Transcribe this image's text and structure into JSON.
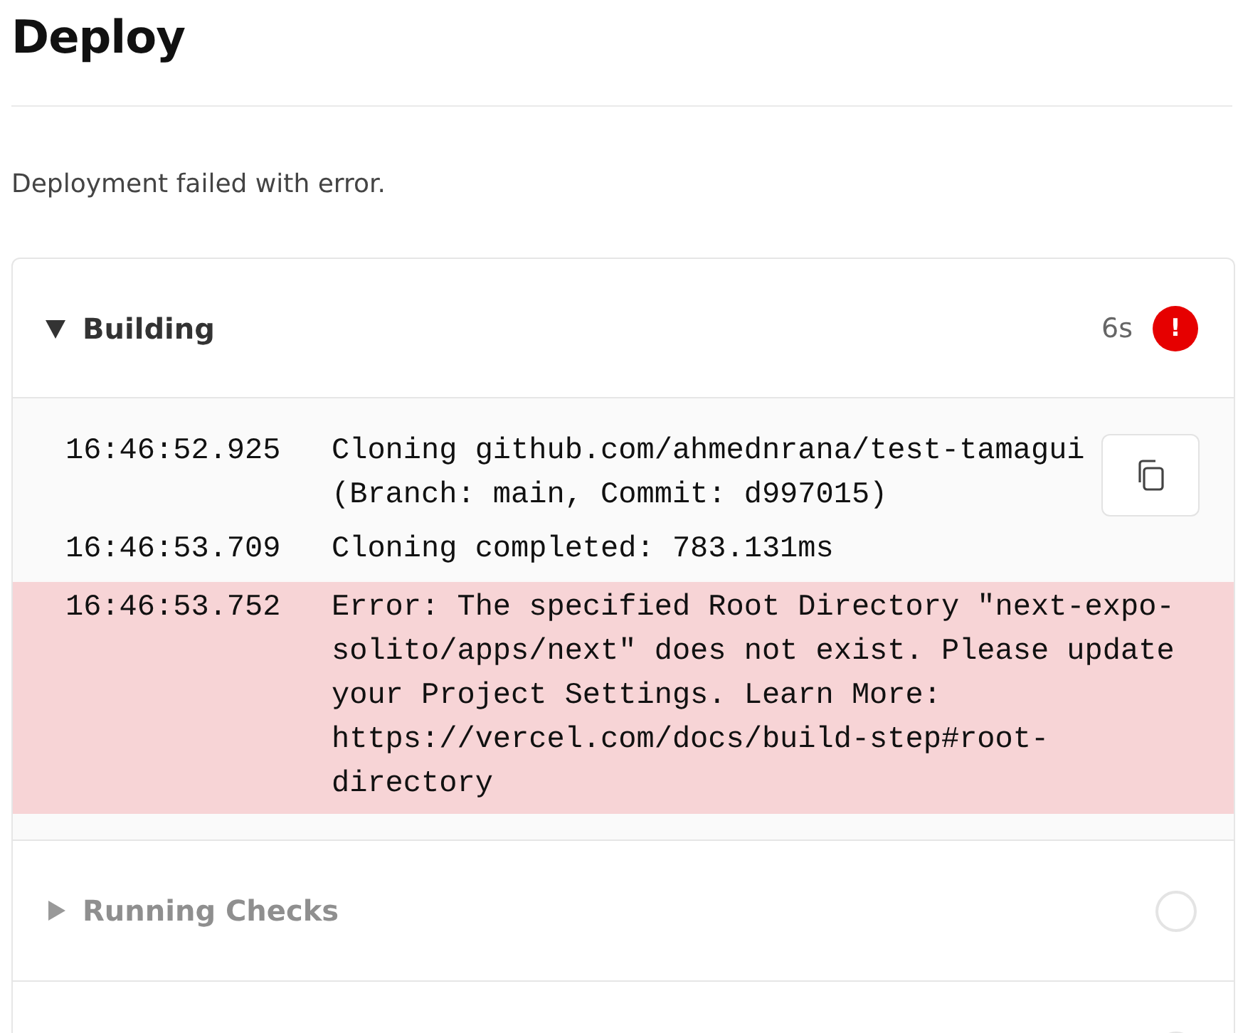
{
  "page": {
    "title": "Deploy",
    "message": "Deployment failed with error."
  },
  "steps": [
    {
      "title": "Building",
      "expanded": true,
      "kind": "error",
      "duration": "6s",
      "status_symbol": "!",
      "log": [
        {
          "time": "16:46:52.925",
          "text": "Cloning github.com/ahmednrana/test-tamagui (Branch: main, Commit: d997015)",
          "kind": "info"
        },
        {
          "time": "16:46:53.709",
          "text": "Cloning completed: 783.131ms",
          "kind": "info"
        },
        {
          "time": "16:46:53.752",
          "text": "Error: The specified Root Directory \"next-expo-solito/apps/next\" does not exist. Please update your Project Settings. Learn More: https://vercel.com/docs/build-step#root-directory",
          "kind": "error"
        }
      ]
    },
    {
      "title": "Running Checks",
      "expanded": false,
      "kind": "pending"
    },
    {
      "kind": "pending"
    }
  ]
}
